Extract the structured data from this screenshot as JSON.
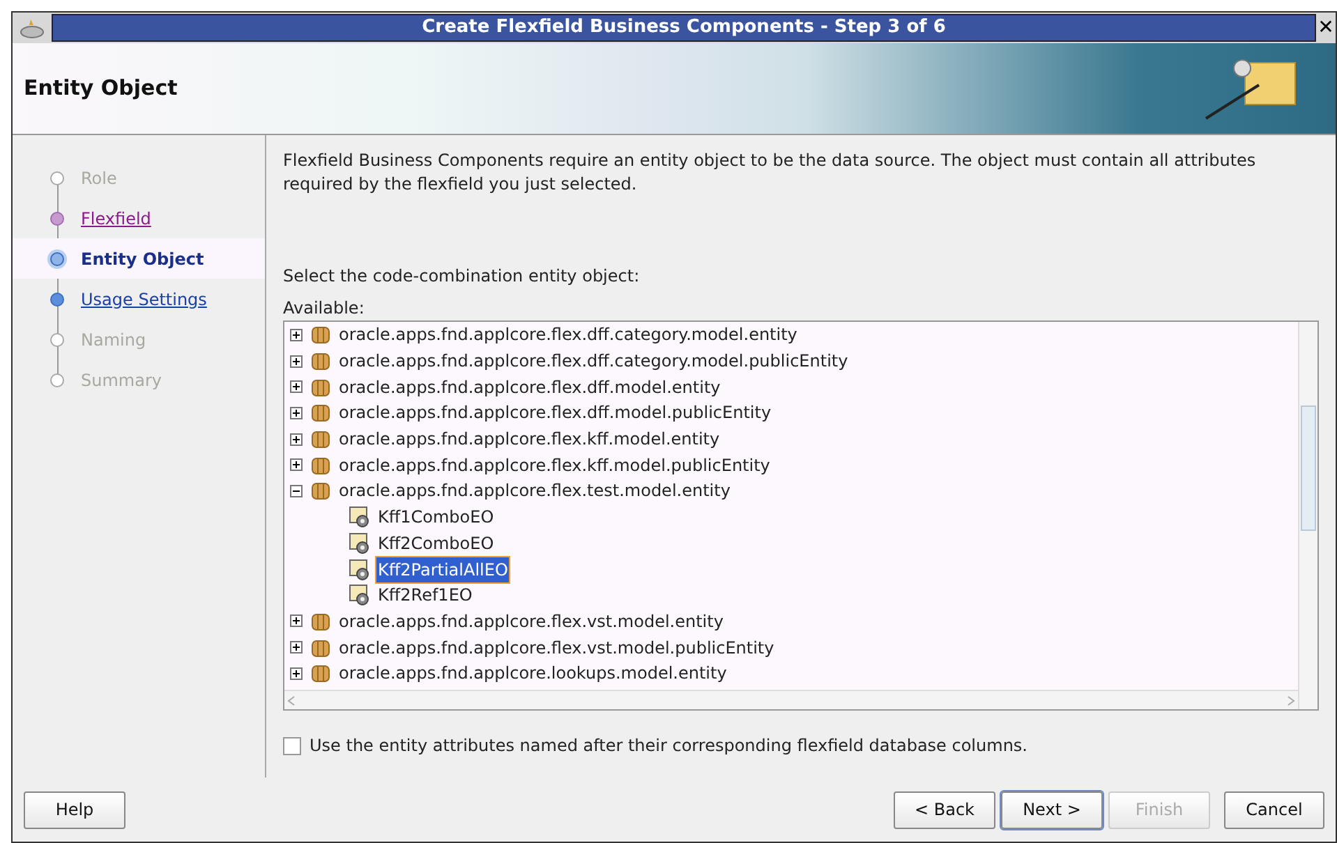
{
  "window": {
    "title": "Create Flexfield Business Components - Step 3 of 6",
    "close": "✕"
  },
  "header": {
    "title": "Entity Object"
  },
  "steps": [
    {
      "label": "Role",
      "disabled": true,
      "visited": false,
      "selected": false
    },
    {
      "label": "Flexfield",
      "disabled": false,
      "visited": true,
      "selected": false
    },
    {
      "label": "Entity Object",
      "disabled": false,
      "visited": false,
      "selected": true
    },
    {
      "label": "Usage Settings",
      "disabled": false,
      "visited": false,
      "selected": false
    },
    {
      "label": "Naming",
      "disabled": true,
      "visited": false,
      "selected": false
    },
    {
      "label": "Summary",
      "disabled": true,
      "visited": false,
      "selected": false
    }
  ],
  "description": "Flexfield Business Components require an entity object to be the data source. The object must contain all attributes required by the flexfield you just selected.",
  "prompt": "Select the code-combination entity object:",
  "tree": {
    "label": "Available:",
    "items": [
      {
        "label": "oracle.apps.fnd.applcore.flex.dff.category.model.entity",
        "expanded": false
      },
      {
        "label": "oracle.apps.fnd.applcore.flex.dff.category.model.publicEntity",
        "expanded": false
      },
      {
        "label": "oracle.apps.fnd.applcore.flex.dff.model.entity",
        "expanded": false
      },
      {
        "label": "oracle.apps.fnd.applcore.flex.dff.model.publicEntity",
        "expanded": false
      },
      {
        "label": "oracle.apps.fnd.applcore.flex.kff.model.entity",
        "expanded": false
      },
      {
        "label": "oracle.apps.fnd.applcore.flex.kff.model.publicEntity",
        "expanded": false
      },
      {
        "label": "oracle.apps.fnd.applcore.flex.test.model.entity",
        "expanded": true,
        "children": [
          {
            "label": "Kff1ComboEO",
            "selected": false
          },
          {
            "label": "Kff2ComboEO",
            "selected": false
          },
          {
            "label": "Kff2PartialAllEO",
            "selected": true
          },
          {
            "label": "Kff2Ref1EO",
            "selected": false
          }
        ]
      },
      {
        "label": "oracle.apps.fnd.applcore.flex.vst.model.entity",
        "expanded": false
      },
      {
        "label": "oracle.apps.fnd.applcore.flex.vst.model.publicEntity",
        "expanded": false
      },
      {
        "label": "oracle.apps.fnd.applcore.lookups.model.entity",
        "expanded": false
      }
    ]
  },
  "option": {
    "label": "Use the entity attributes named after their corresponding flexfield database columns.",
    "checked": false
  },
  "buttons": [
    {
      "label": "Help",
      "kind": "help",
      "disabled": false,
      "default": false
    },
    {
      "label": "< Back",
      "kind": "nav",
      "disabled": false,
      "default": false
    },
    {
      "label": "Next >",
      "kind": "nav",
      "disabled": false,
      "default": true
    },
    {
      "label": "Finish",
      "kind": "nav",
      "disabled": true,
      "default": false
    },
    {
      "label": "Cancel",
      "kind": "cancel",
      "disabled": false,
      "default": false
    }
  ]
}
